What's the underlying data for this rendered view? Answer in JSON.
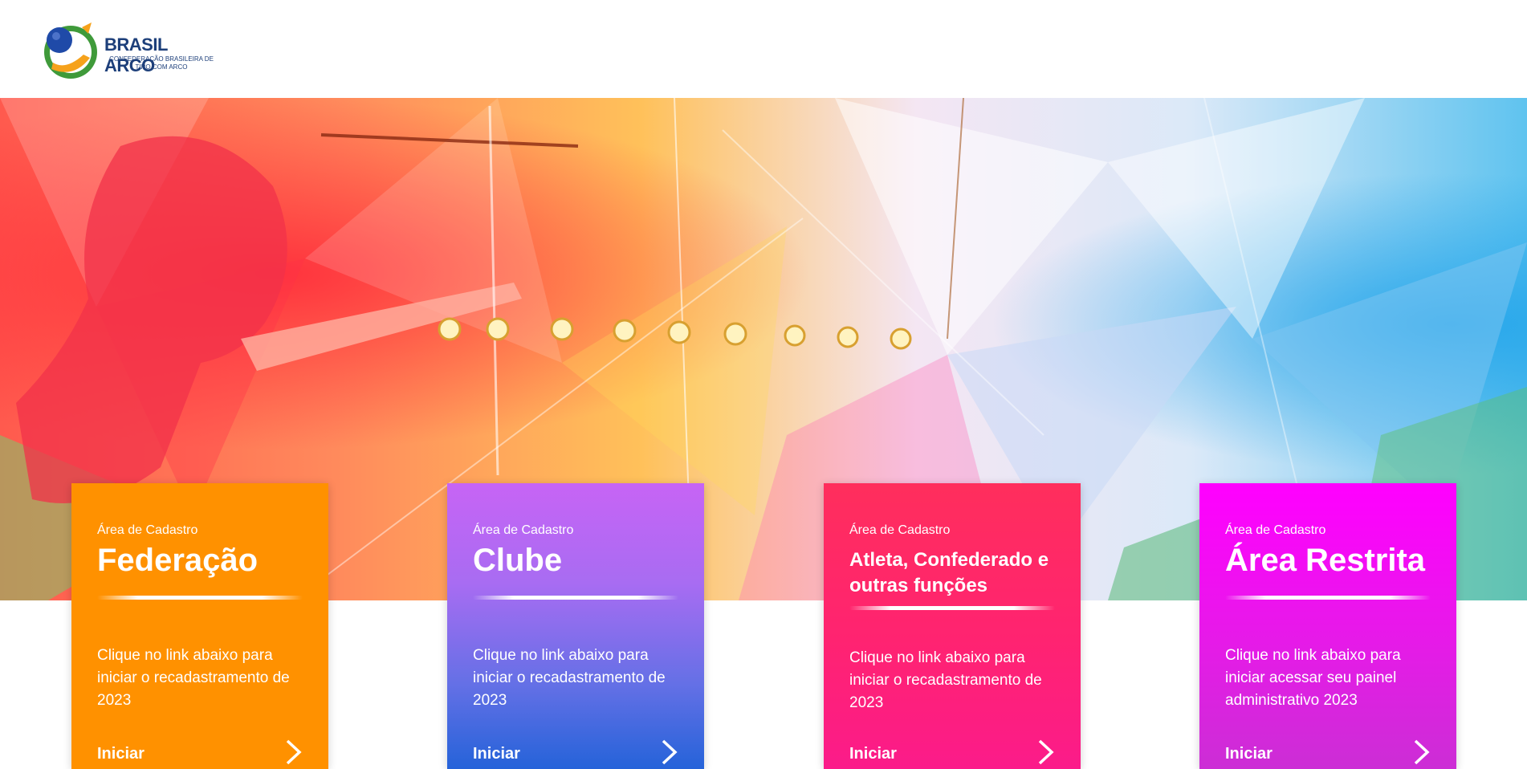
{
  "brand": {
    "name": "BRASIL ARCO",
    "subtitle": "CONFEDERAÇÃO BRASILEIRA DE TIRO COM ARCO"
  },
  "hero": {
    "icon": "archery-banner"
  },
  "cards": [
    {
      "kicker": "Área de Cadastro",
      "title": "Federação",
      "text": "Clique no link abaixo para iniciar o recadastramento de 2023",
      "cta": "Iniciar",
      "color": "#ff9100"
    },
    {
      "kicker": "Área de Cadastro",
      "title": "Clube",
      "text": "Clique no link abaixo para iniciar o recadastramento de 2023",
      "cta": "Iniciar",
      "color": "#a86cf2"
    },
    {
      "kicker": "Área de Cadastro",
      "title": "Atleta, Confederado e outras funções",
      "text": "Clique no link abaixo para iniciar o recadastramento de 2023",
      "cta": "Iniciar",
      "color": "#ff2371"
    },
    {
      "kicker": "Área de Cadastro",
      "title": "Área Restrita",
      "text": "Clique no link abaixo para iniciar acessar seu painel administrativo 2023",
      "cta": "Iniciar",
      "color": "#ff00ff"
    }
  ]
}
